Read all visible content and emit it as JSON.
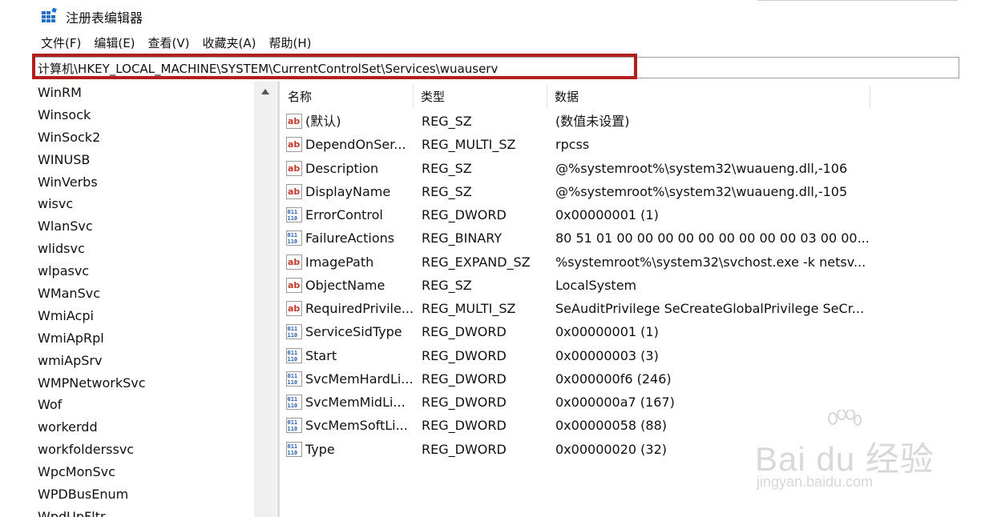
{
  "window": {
    "title": "注册表编辑器"
  },
  "menu": [
    {
      "label": "文件(F)"
    },
    {
      "label": "编辑(E)"
    },
    {
      "label": "查看(V)"
    },
    {
      "label": "收藏夹(A)"
    },
    {
      "label": "帮助(H)"
    }
  ],
  "address": {
    "path": "计算机\\HKEY_LOCAL_MACHINE\\SYSTEM\\CurrentControlSet\\Services\\wuauserv",
    "highlight_color": "#b01e1e"
  },
  "tree": {
    "items": [
      "WinRM",
      "Winsock",
      "WinSock2",
      "WINUSB",
      "WinVerbs",
      "wisvc",
      "WlanSvc",
      "wlidsvc",
      "wlpasvc",
      "WManSvc",
      "WmiAcpi",
      "WmiApRpl",
      "wmiApSrv",
      "WMPNetworkSvc",
      "Wof",
      "workerdd",
      "workfolderssvc",
      "WpcMonSvc",
      "WPDBusEnum",
      "WpdUpFltr"
    ]
  },
  "columns": {
    "name": "名称",
    "type": "类型",
    "data": "数据"
  },
  "values": [
    {
      "icon": "string-value-icon",
      "name": "(默认)",
      "type": "REG_SZ",
      "data": "(数值未设置)"
    },
    {
      "icon": "string-value-icon",
      "name": "DependOnSer...",
      "type": "REG_MULTI_SZ",
      "data": "rpcss"
    },
    {
      "icon": "string-value-icon",
      "name": "Description",
      "type": "REG_SZ",
      "data": "@%systemroot%\\system32\\wuaueng.dll,-106"
    },
    {
      "icon": "string-value-icon",
      "name": "DisplayName",
      "type": "REG_SZ",
      "data": "@%systemroot%\\system32\\wuaueng.dll,-105"
    },
    {
      "icon": "binary-value-icon",
      "name": "ErrorControl",
      "type": "REG_DWORD",
      "data": "0x00000001 (1)"
    },
    {
      "icon": "binary-value-icon",
      "name": "FailureActions",
      "type": "REG_BINARY",
      "data": "80 51 01 00 00 00 00 00 00 00 00 00 03 00 00..."
    },
    {
      "icon": "string-value-icon",
      "name": "ImagePath",
      "type": "REG_EXPAND_SZ",
      "data": "%systemroot%\\system32\\svchost.exe -k netsv..."
    },
    {
      "icon": "string-value-icon",
      "name": "ObjectName",
      "type": "REG_SZ",
      "data": "LocalSystem"
    },
    {
      "icon": "string-value-icon",
      "name": "RequiredPrivile...",
      "type": "REG_MULTI_SZ",
      "data": "SeAuditPrivilege SeCreateGlobalPrivilege SeCr..."
    },
    {
      "icon": "binary-value-icon",
      "name": "ServiceSidType",
      "type": "REG_DWORD",
      "data": "0x00000001 (1)"
    },
    {
      "icon": "binary-value-icon",
      "name": "Start",
      "type": "REG_DWORD",
      "data": "0x00000003 (3)"
    },
    {
      "icon": "binary-value-icon",
      "name": "SvcMemHardLi...",
      "type": "REG_DWORD",
      "data": "0x000000f6 (246)"
    },
    {
      "icon": "binary-value-icon",
      "name": "SvcMemMidLi...",
      "type": "REG_DWORD",
      "data": "0x000000a7 (167)"
    },
    {
      "icon": "binary-value-icon",
      "name": "SvcMemSoftLi...",
      "type": "REG_DWORD",
      "data": "0x00000058 (88)"
    },
    {
      "icon": "binary-value-icon",
      "name": "Type",
      "type": "REG_DWORD",
      "data": "0x00000020 (32)"
    }
  ],
  "watermark": {
    "brand": "Bai du 经验",
    "url": "jingyan.baidu.com"
  }
}
